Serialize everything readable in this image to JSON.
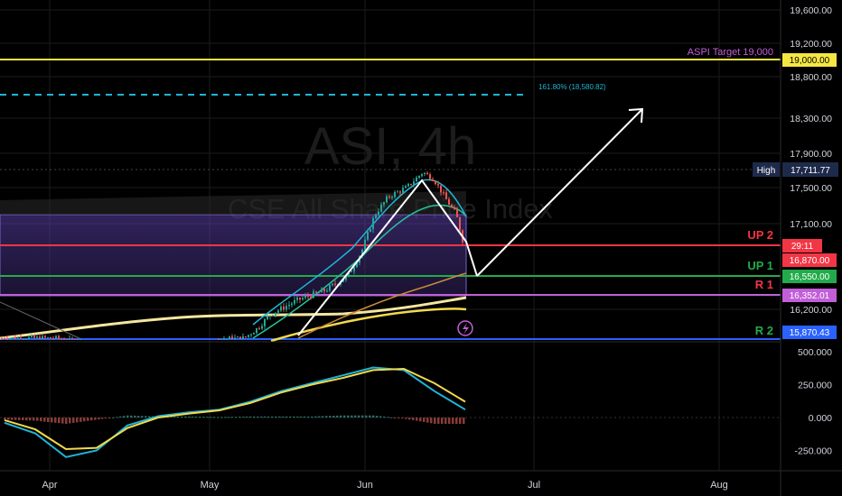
{
  "colors": {
    "background": "#000000",
    "up": "#26a69a",
    "down": "#ef5350",
    "target_line": "#f5e642",
    "fib_line": "#1fb5d6",
    "up2": "#f23645",
    "up1": "#22ab4a",
    "r1": "#c25fd8",
    "r2": "#2962ff",
    "text": "#d1d4dc",
    "ema_fast": "#1fb5d6",
    "ema_mid": "#26c29a",
    "ema_slow": "#c98a3a",
    "ma_200": "#f5e6a0"
  },
  "watermark": {
    "symbol": "ASI, 4h",
    "name": "CSE All Share Price Index"
  },
  "annotations": {
    "target_label": "ASPI Target 19,000",
    "fib_label": "161.80% (18,580.82)",
    "high_label": "High",
    "up2_label": "UP 2",
    "up1_label": "UP 1",
    "r1_label": "R 1",
    "r2_label": "R 2",
    "flash_icon": "lightning-icon"
  },
  "price_badges": {
    "target": "19,000.00",
    "high": "17,711.77",
    "countdown": "29:11",
    "up2": "16,870.00",
    "up1": "16,550.00",
    "r1": "16,352.01",
    "r2": "15,870.43"
  },
  "chart_data": [
    {
      "type": "candlestick",
      "title": "ASI, 4h",
      "subtitle": "CSE All Share Price Index",
      "xlabel": "",
      "ylabel": "",
      "x_ticks": [
        "Apr",
        "May",
        "Jun",
        "Jul",
        "Aug"
      ],
      "y_ticks": [
        "16,200.00",
        "17,100.00",
        "17,500.00",
        "17,900.00",
        "18,300.00",
        "18,800.00",
        "19,200.00",
        "19,600.00"
      ],
      "ylim": [
        15800,
        19700
      ],
      "levels": [
        {
          "name": "ASPI Target 19,000",
          "value": 19000
        },
        {
          "name": "161.80% (18,580.82)",
          "value": 18580.82
        },
        {
          "name": "High",
          "value": 17711.77
        },
        {
          "name": "UP 2",
          "value": 16870
        },
        {
          "name": "UP 1",
          "value": 16550
        },
        {
          "name": "R 1",
          "value": 16352.01
        },
        {
          "name": "R 2",
          "value": 15870.43
        }
      ],
      "price_path": [
        {
          "x": "Apr",
          "y": 15880
        },
        {
          "x": "late Apr",
          "y": 15860
        },
        {
          "x": "May",
          "y": 15870
        },
        {
          "x": "mid May",
          "y": 16150
        },
        {
          "x": "late May",
          "y": 16350
        },
        {
          "x": "Jun",
          "y": 16900
        },
        {
          "x": "early Jun",
          "y": 17450
        },
        {
          "x": "mid Jun",
          "y": 17700
        },
        {
          "x": "mid Jun",
          "y": 17500
        },
        {
          "x": "late Jun",
          "y": 17100
        },
        {
          "x": "late Jun",
          "y": 16800
        }
      ],
      "projection": [
        {
          "x": "late Jun",
          "y": 16800
        },
        {
          "x": "late Jun",
          "y": 16500
        },
        {
          "x": "mid Jul",
          "y": 18400
        }
      ]
    },
    {
      "type": "line",
      "title": "",
      "x_ticks": [
        "Apr",
        "May",
        "Jun",
        "Jul",
        "Aug"
      ],
      "y_ticks": [
        "500.000",
        "250.000",
        "0.000",
        "-250.000"
      ],
      "ylim": [
        -380,
        560
      ],
      "series": [
        {
          "values": [
            -40,
            -120,
            -300,
            -250,
            -60,
            10,
            40,
            60,
            120,
            200,
            260,
            320,
            380,
            360,
            200,
            60
          ]
        },
        {
          "values": [
            -20,
            -90,
            -240,
            -230,
            -80,
            0,
            30,
            55,
            110,
            190,
            250,
            300,
            360,
            370,
            260,
            120
          ]
        }
      ]
    }
  ]
}
